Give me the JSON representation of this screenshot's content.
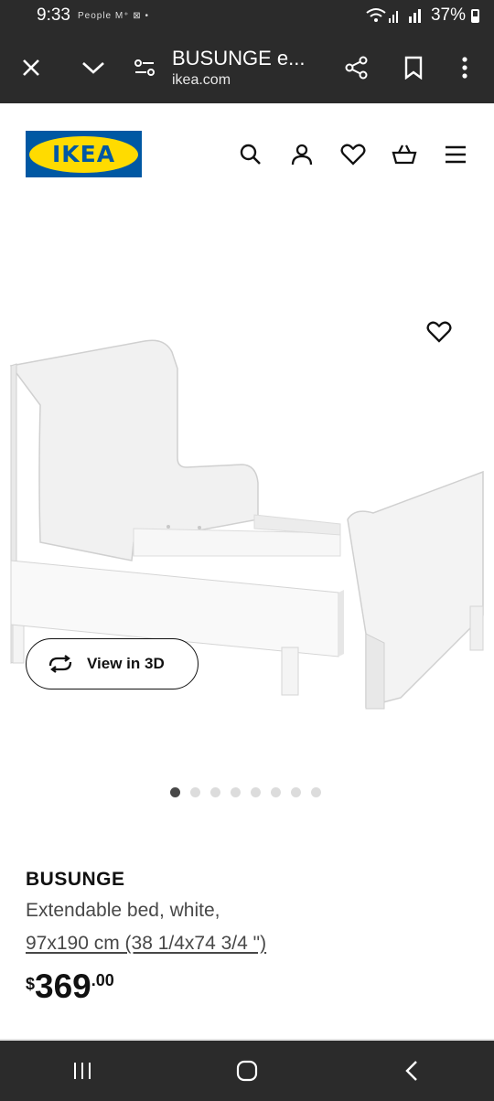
{
  "status_bar": {
    "time": "9:33",
    "mini_icons": "People M⁺ ⊠ •",
    "battery": "37%"
  },
  "browser": {
    "page_title": "BUSUNGE e...",
    "domain": "ikea.com"
  },
  "site": {
    "logo_text": "IKEA",
    "brand_colors": {
      "blue": "#0058a3",
      "yellow": "#ffdb00"
    }
  },
  "gallery": {
    "view3d_label": "View in 3D",
    "image_count": 8,
    "active_index": 0
  },
  "product": {
    "name": "BUSUNGE",
    "description": "Extendable bed, white,",
    "size": "97x190 cm (38 1/4x74 3/4 \")",
    "price_currency": "$",
    "price_integer": "369",
    "price_decimal": ".00"
  }
}
